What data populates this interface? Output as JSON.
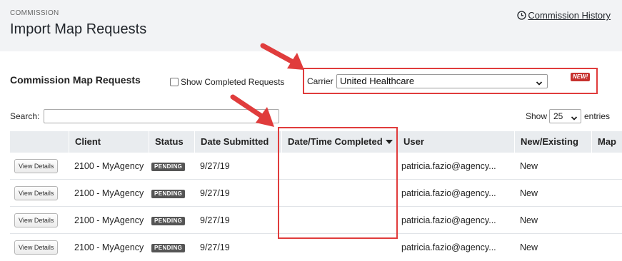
{
  "header": {
    "section_label": "COMMISSION",
    "title": "Import Map Requests",
    "history_link": "Commission History",
    "history_icon": "clock-icon"
  },
  "requests": {
    "title": "Commission Map Requests",
    "show_completed_label": "Show Completed Requests",
    "show_completed_checked": false
  },
  "carrier": {
    "label": "Carrier",
    "selected": "United Healthcare",
    "new_badge": "NEW!"
  },
  "search": {
    "label": "Search:",
    "value": "",
    "placeholder": ""
  },
  "entries": {
    "show_label": "Show",
    "selected": "25",
    "suffix": "entries"
  },
  "table": {
    "columns": [
      "",
      "Client",
      "Status",
      "Date Submitted",
      "Date/Time Completed",
      "User",
      "New/Existing",
      "Map"
    ],
    "sorted_column": "Date/Time Completed",
    "rows": [
      {
        "action": "View Details",
        "client": "2100 - MyAgency",
        "status": "PENDING",
        "date_submitted": "9/27/19",
        "completed": "",
        "user": "patricia.fazio@agency...",
        "new_existing": "New"
      },
      {
        "action": "View Details",
        "client": "2100 - MyAgency",
        "status": "PENDING",
        "date_submitted": "9/27/19",
        "completed": "",
        "user": "patricia.fazio@agency...",
        "new_existing": "New"
      },
      {
        "action": "View Details",
        "client": "2100 - MyAgency",
        "status": "PENDING",
        "date_submitted": "9/27/19",
        "completed": "",
        "user": "patricia.fazio@agency...",
        "new_existing": "New"
      },
      {
        "action": "View Details",
        "client": "2100 - MyAgency",
        "status": "PENDING",
        "date_submitted": "9/27/19",
        "completed": "",
        "user": "patricia.fazio@agency...",
        "new_existing": "New"
      }
    ]
  },
  "colors": {
    "annotation_red": "#e03c3c",
    "header_bg": "#f2f3f5",
    "badge_new": "#c7312e",
    "status_pending": "#555555"
  }
}
